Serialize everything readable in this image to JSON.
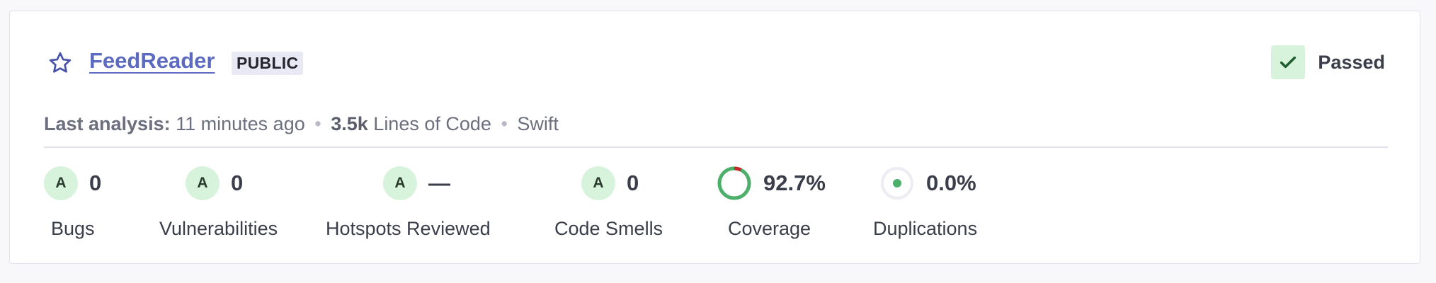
{
  "project": {
    "name": "FeedReader",
    "visibility": "PUBLIC"
  },
  "quality_gate": {
    "status": "Passed",
    "color": "#2b8a3e",
    "icon": "check-icon"
  },
  "meta": {
    "last_analysis_label": "Last analysis:",
    "last_analysis_value": "11 minutes ago",
    "separator": "•",
    "loc_value": "3.5k",
    "loc_label": "Lines of Code",
    "language": "Swift"
  },
  "metrics": {
    "bugs": {
      "rating": "A",
      "value": "0",
      "label": "Bugs"
    },
    "vulnerabilities": {
      "rating": "A",
      "value": "0",
      "label": "Vulnerabilities"
    },
    "hotspots": {
      "rating": "A",
      "value": "—",
      "label": "Hotspots Reviewed"
    },
    "code_smells": {
      "rating": "A",
      "value": "0",
      "label": "Code Smells"
    },
    "coverage": {
      "value": "92.7%",
      "label": "Coverage",
      "percent": 92.7,
      "covered_color": "#4caf6a",
      "uncovered_color": "#c62828"
    },
    "duplications": {
      "value": "0.0%",
      "label": "Duplications",
      "percent": 0.0,
      "dot_color": "#4caf6a"
    }
  },
  "colors": {
    "accent": "#5c6bc0",
    "rating_a_bg": "#d7f3dc",
    "pass_bg": "#d7f3dc"
  }
}
